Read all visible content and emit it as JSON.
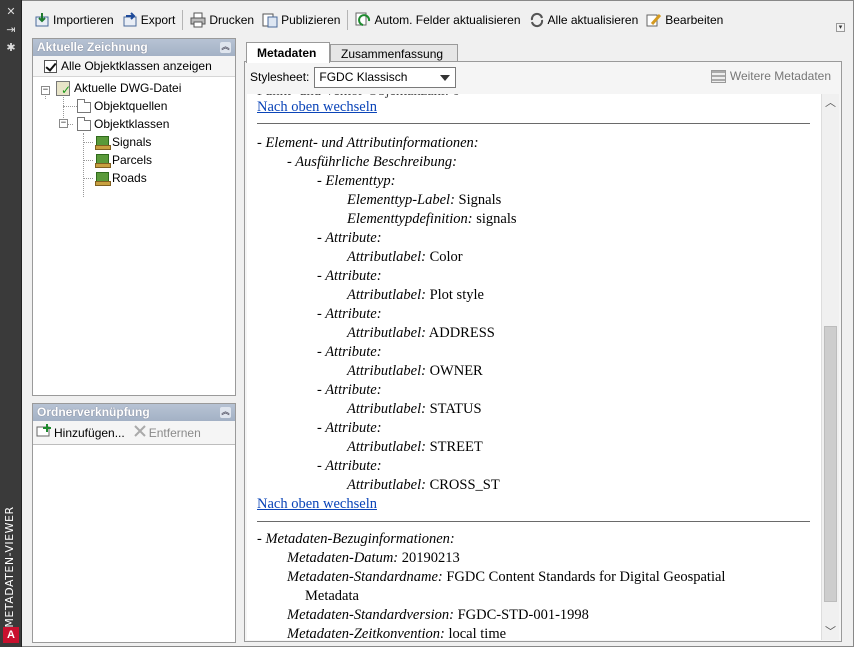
{
  "palette": {
    "title": "METADATEN-VIEWER",
    "icons": [
      "close-icon",
      "auto-hide-icon",
      "properties-icon"
    ],
    "logo": "A"
  },
  "toolbar": {
    "import_label": "Importieren",
    "export_label": "Export",
    "print_label": "Drucken",
    "publish_label": "Publizieren",
    "auto_update_label": "Autom. Felder aktualisieren",
    "update_all_label": "Alle aktualisieren",
    "edit_label": "Bearbeiten"
  },
  "current_drawing": {
    "header": "Aktuelle Zeichnung",
    "show_all_label": "Alle Objektklassen anzeigen",
    "show_all_checked": true,
    "tree": {
      "root": "Aktuelle DWG-Datei",
      "sources": "Objektquellen",
      "classes": "Objektklassen",
      "items": [
        "Signals",
        "Parcels",
        "Roads"
      ]
    }
  },
  "folder_links": {
    "header": "Ordnerverknüpfung",
    "add_label": "Hinzufügen...",
    "remove_label": "Entfernen"
  },
  "tabs": {
    "metadata": "Metadaten",
    "summary": "Zusammenfassung",
    "active": "metadata"
  },
  "stylesheet": {
    "label": "Stylesheet:",
    "value": "FGDC Klassisch",
    "more_label": "Weitere Metadaten"
  },
  "document": {
    "top_link": "Nach oben wechseln",
    "entity_section": "- Element- und Attributinformationen:",
    "detailed_desc": "- Ausführliche Beschreibung:",
    "entity_type": "- Elementtyp:",
    "entity_label_key": "Elementtyp-Label:",
    "entity_label_value": "Signals",
    "entity_def_key": "Elementtypdefinition:",
    "entity_def_value": "signals",
    "attribute_key": "- Attribute:",
    "attr_label_key": "Attributlabel:",
    "attributes": [
      "Color",
      "Plot style",
      "ADDRESS",
      "OWNER",
      "STATUS",
      "STREET",
      "CROSS_ST"
    ],
    "top_link_2": "Nach oben wechseln",
    "meta_ref": "- Metadaten-Bezuginformationen:",
    "meta_date_key": "Metadaten-Datum:",
    "meta_date_value": "20190213",
    "meta_std_name_key": "Metadaten-Standardname:",
    "meta_std_name_value": "FGDC Content Standards for Digital Geospatial",
    "meta_std_name_cont": "Metadata",
    "meta_std_version_key": "Metadaten-Standardversion:",
    "meta_std_version_value": "FGDC-STD-001-1998",
    "meta_time_key": "Metadaten-Zeitkonvention:",
    "meta_time_value": "local time"
  }
}
